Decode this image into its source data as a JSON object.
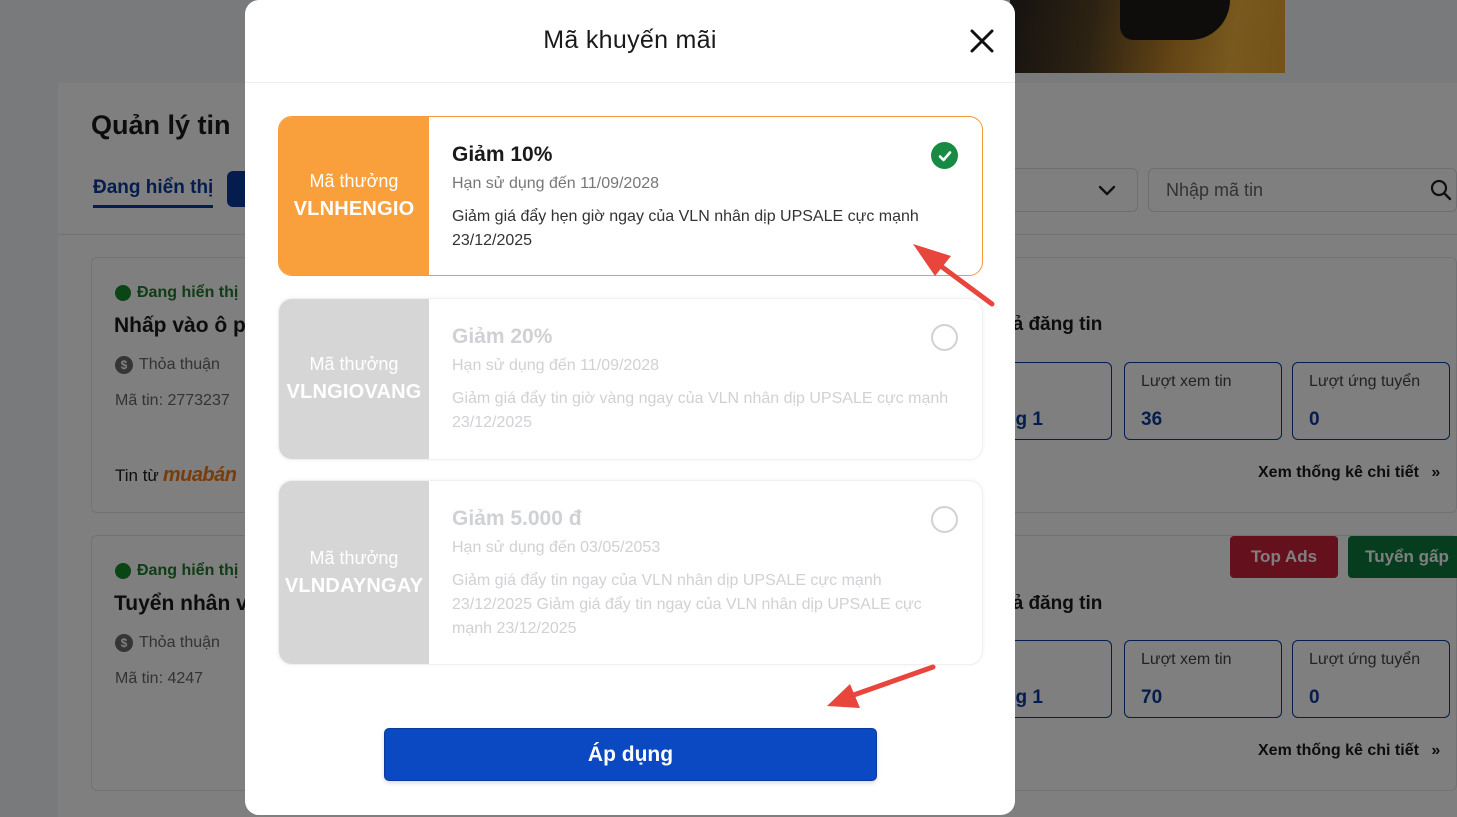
{
  "background": {
    "panel_title": "Quản lý tin",
    "tab_active": "Đang hiển thị",
    "search_placeholder": "Nhập mã tin",
    "listings": [
      {
        "status": "Đang hiển thị",
        "title": "Nhấp vào ô p",
        "salary": "Thỏa thuận",
        "code": "Mã tin: 2773237",
        "source_prefix": "Tin từ",
        "source_brand": "muabán",
        "result_heading": "uả đăng tin",
        "stat_partial": "g 1",
        "views_label": "Lượt xem tin",
        "views_value": "36",
        "applies_label": "Lượt ứng tuyển",
        "applies_value": "0",
        "detail_link": "Xem thống kê chi tiết"
      },
      {
        "status": "Đang hiển thị",
        "title": "Tuyển nhân v",
        "salary": "Thỏa thuận",
        "code": "Mã tin: 4247",
        "result_heading": "uả đăng tin",
        "stat_partial": "g 1",
        "views_label": "Lượt xem tin",
        "views_value": "70",
        "applies_label": "Lượt ứng tuyển",
        "applies_value": "0",
        "detail_link": "Xem thống kê chi tiết",
        "badge_top_ads": "Top Ads",
        "badge_urgent": "Tuyển gấp"
      }
    ]
  },
  "modal": {
    "title": "Mã khuyến mãi",
    "apply_label": "Áp dụng",
    "coupons": [
      {
        "kind": "Mã thưởng",
        "code": "VLNHENGIO",
        "title": "Giảm 10%",
        "expiry": "Hạn sử dụng đến 11/09/2028",
        "description": "Giảm giá đẩy hẹn giờ ngay của VLN nhân dịp UPSALE cực mạnh 23/12/2025",
        "selected": true
      },
      {
        "kind": "Mã thưởng",
        "code": "VLNGIOVANG",
        "title": "Giảm 20%",
        "expiry": "Hạn sử dụng đến 11/09/2028",
        "description": "Giảm giá đẩy tin giờ vàng ngay của VLN nhân dịp UPSALE cực mạnh 23/12/2025",
        "selected": false
      },
      {
        "kind": "Mã thưởng",
        "code": "VLNDAYNGAY",
        "title": "Giảm 5.000 đ",
        "expiry": "Hạn sử dụng đến 03/05/2053",
        "description": "Giảm giá đẩy tin ngay của VLN nhân dịp UPSALE cực mạnh 23/12/2025 Giảm giá đẩy tin ngay của VLN nhân dịp UPSALE cực mạnh 23/12/2025",
        "selected": false
      }
    ]
  },
  "colors": {
    "brand_blue": "#0b3a9c",
    "apply_blue": "#0a49c2",
    "coupon_orange": "#f9a03d",
    "check_green": "#178a44",
    "annotation_red": "#e8453c",
    "badge_red": "#c9213a",
    "badge_green": "#0d7a3e"
  },
  "icons": [
    "close-icon",
    "check-icon",
    "search-icon",
    "chevron-down-icon",
    "coin-icon",
    "chevron-double-right-icon",
    "annotation-arrow"
  ]
}
